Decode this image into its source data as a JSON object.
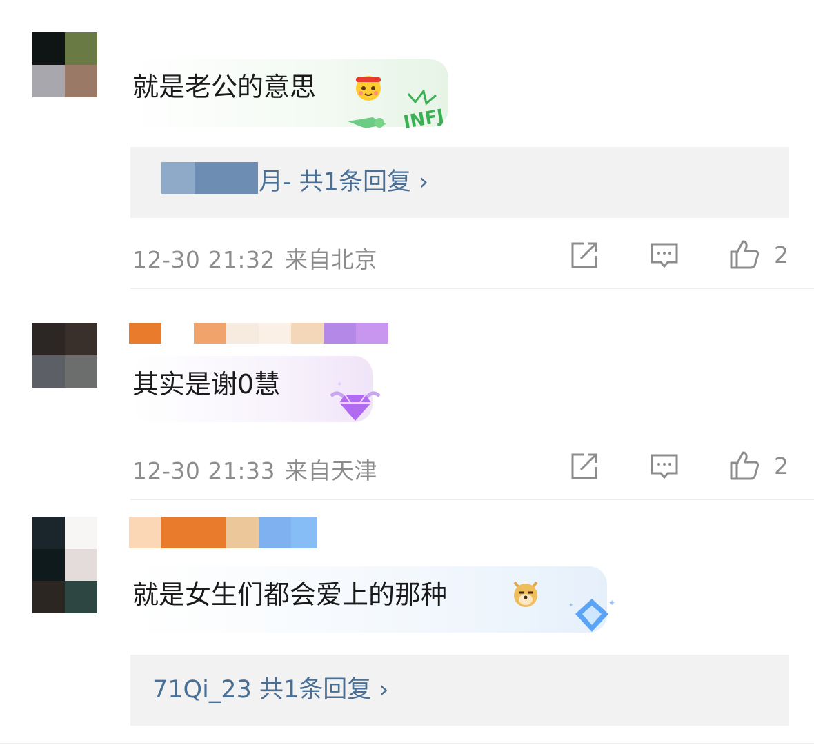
{
  "comments": [
    {
      "text": "就是老公的意思",
      "emoji": "blush-headband-emoji",
      "reply": {
        "prefix": "月- ",
        "summary": "共1条回复 ›"
      },
      "time": "12-30 21:32",
      "location": "来自北京",
      "likes": "2",
      "bubble_badge": "INFJ"
    },
    {
      "text": "其实是谢0慧",
      "time": "12-30 21:33",
      "location": "来自天津",
      "likes": "2",
      "bubble_badge": "diamond-wings-badge"
    },
    {
      "text": "就是女生们都会爱上的那种",
      "emoji": "doge-emoji",
      "reply": {
        "prefix": "71Qi_23",
        "summary": "共1条回复 ›"
      },
      "bubble_badge": "blue-diamond-badge"
    }
  ],
  "colors": {
    "link": "#4a6f95",
    "meta": "#8c8c8c",
    "reply_bg": "#f2f2f2"
  }
}
